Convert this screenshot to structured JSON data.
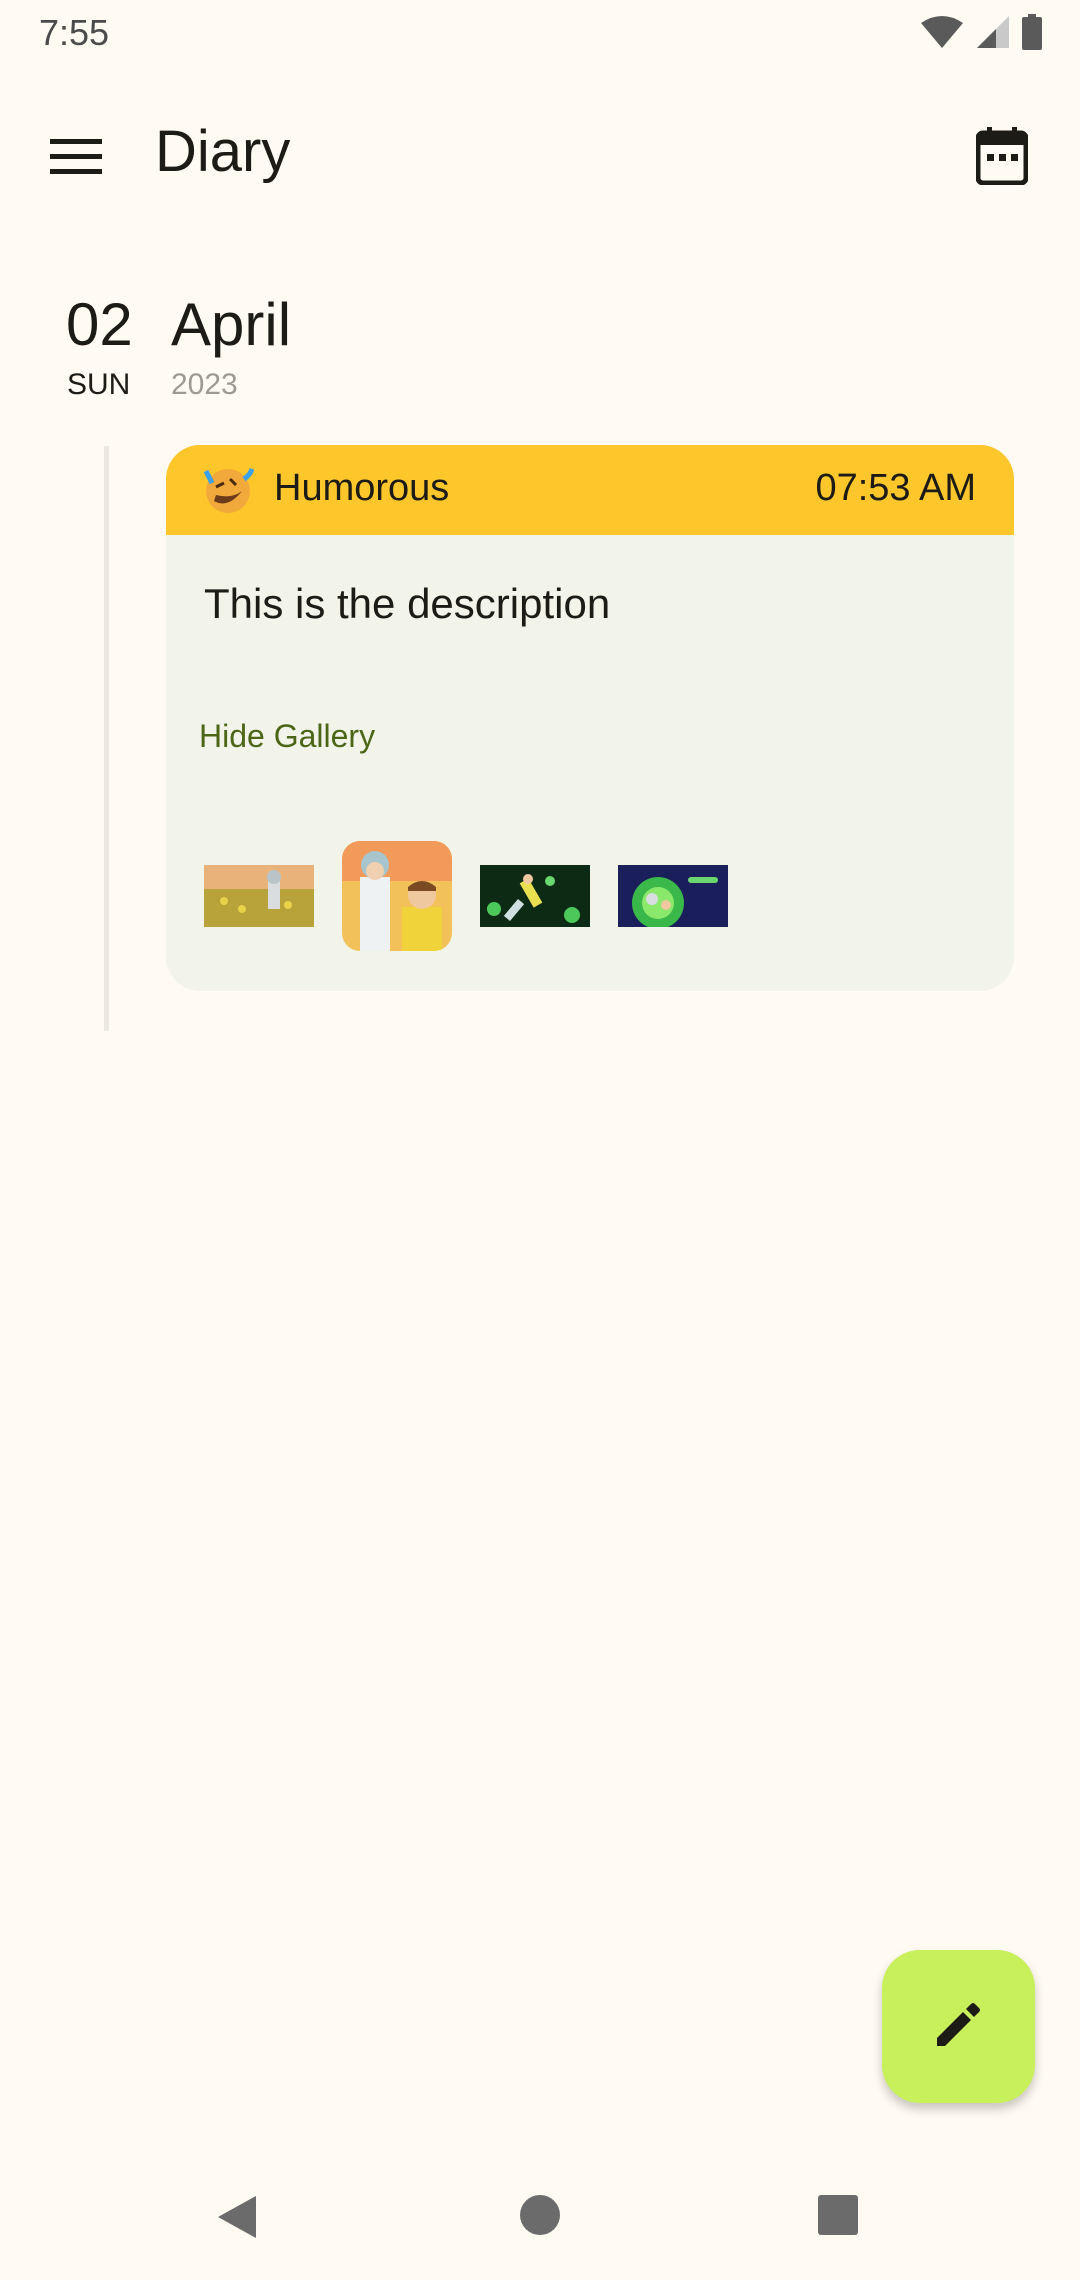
{
  "status_bar": {
    "time": "7:55"
  },
  "app_bar": {
    "title": "Diary"
  },
  "date_header": {
    "day": "02",
    "weekday": "SUN",
    "month": "April",
    "year": "2023"
  },
  "entry": {
    "mood": "Humorous",
    "time": "07:53 AM",
    "description": "This is the description",
    "gallery_toggle": "Hide Gallery",
    "images": [
      "field-scene-thumbnail",
      "rick-and-morty-thumbnail",
      "space-scene-thumbnail",
      "portal-scene-thumbnail"
    ]
  },
  "colors": {
    "background": "#fffbf3",
    "card": "#f2f3e9",
    "mood_header": "#fdc72c",
    "fab": "#c8f05a",
    "link": "#4c6618"
  },
  "icons": [
    "menu-icon",
    "calendar-icon",
    "rolling-laughing-icon",
    "pencil-icon",
    "back-icon",
    "home-icon",
    "recents-icon"
  ]
}
